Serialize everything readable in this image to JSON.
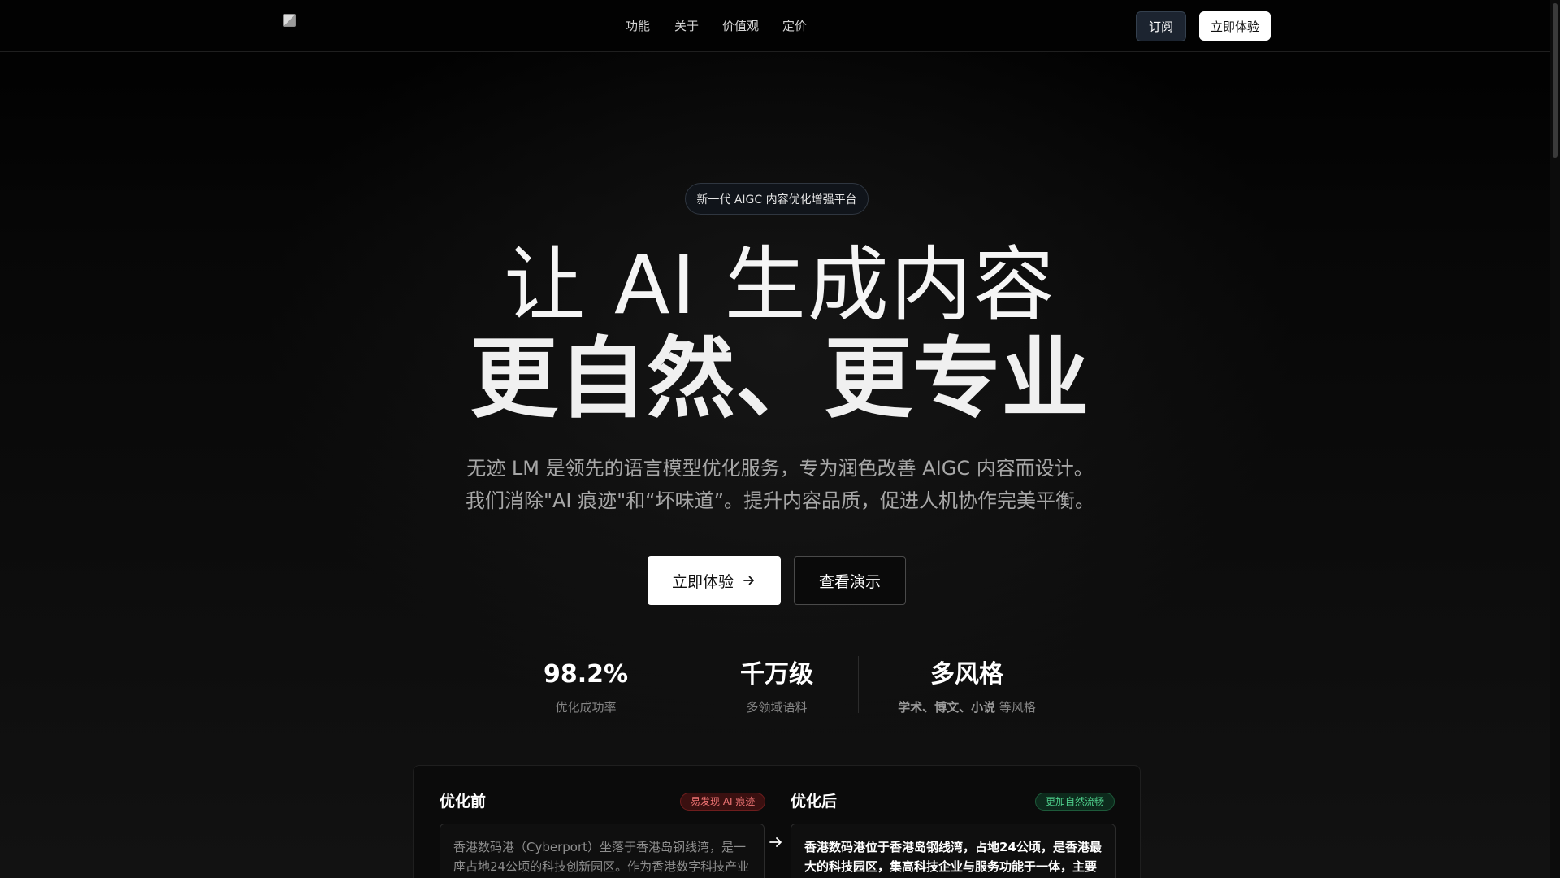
{
  "nav": {
    "logo_alt": "",
    "links": [
      "功能",
      "关于",
      "价值观",
      "定价"
    ],
    "subscribe_label": "订阅",
    "try_label": "立即体验"
  },
  "hero": {
    "badge": "新一代 AIGC 内容优化增强平台",
    "title_line1": "让 AI 生成内容",
    "title_line2": "更自然、更专业",
    "desc_line1": "无迹 LM 是领先的语言模型优化服务，专为润色改善 AIGC 内容而设计。",
    "desc_line2": "我们消除\"AI 痕迹\"和“坏味道”。提升内容品质，促进人机协作完美平衡。",
    "cta_primary": "立即体验",
    "cta_secondary": "查看演示"
  },
  "stats": [
    {
      "value": "98.2%",
      "label": "优化成功率"
    },
    {
      "value": "千万级",
      "label": "多领域语料"
    },
    {
      "value": "多风格",
      "label_bold": "学术、博文、小说",
      "label_rest": " 等风格"
    }
  ],
  "compare": {
    "before_title": "优化前",
    "before_tag": "易发现 AI 痕迹",
    "before_text": "香港数码港（Cyberport）坐落于香港岛钢线湾，是一座占地24公顷的科技创新园区。作为香港数字科技产业的重要",
    "after_title": "优化后",
    "after_tag": "更加自然流畅",
    "after_text": "香港数码港位于香港岛钢线湾，占地24公顷，是香港最大的科技园区，集高科技企业与服务功能于一体，主要面向全"
  },
  "colors": {
    "background": "#050505",
    "accent_red": "#f07474",
    "accent_green": "#4fd08c",
    "subscribe_bg": "#1c2430"
  },
  "icons": {
    "cta_arrow": "arrow-right-icon",
    "compare_arrow": "arrow-right-icon",
    "logo": "broken-image-icon"
  }
}
